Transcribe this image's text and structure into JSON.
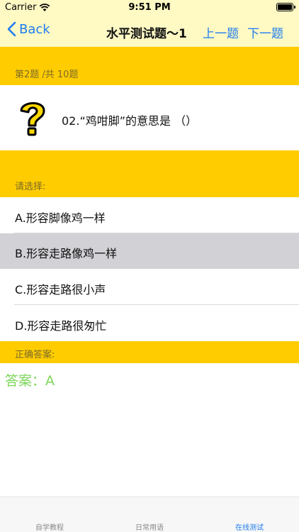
{
  "status_bar": {
    "carrier": "Carrier",
    "time": "9:51 PM"
  },
  "nav": {
    "back_label": "Back",
    "title": "水平测试题～1",
    "prev_label": "上一题",
    "next_label": "下一题"
  },
  "progress": {
    "label": "第2题 /共 10题"
  },
  "question": {
    "text": "02.“鸡咁脚”的意思是 （）"
  },
  "choices_header": "请选择:",
  "options": [
    {
      "label": "A.形容脚像鸡一样"
    },
    {
      "label": "B.形容走路像鸡一样"
    },
    {
      "label": "C.形容走路很小声"
    },
    {
      "label": "D.形容走路很匆忙"
    }
  ],
  "answer_header": "正确答案:",
  "answer_text": "答案：A",
  "tabs": [
    {
      "label": "自学教程"
    },
    {
      "label": "日常用语"
    },
    {
      "label": "在线测试"
    }
  ],
  "colors": {
    "accent": "#1e7cf0",
    "header_yellow": "#ffcc00",
    "nav_bg": "#fff9c4",
    "answer_green": "#7cd65a",
    "selected_row": "#d1d1d6"
  }
}
